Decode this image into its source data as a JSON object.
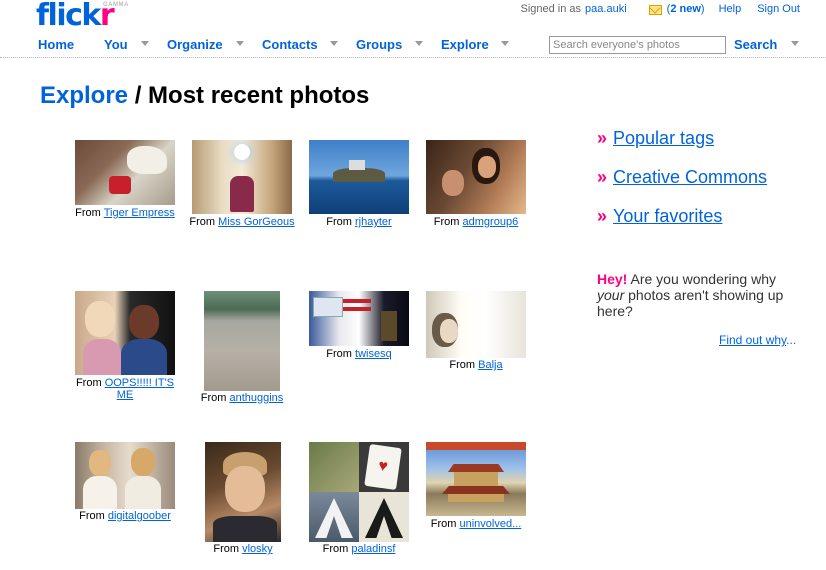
{
  "logo": {
    "part1": "flick",
    "part2": "r",
    "badge": "GAMMA"
  },
  "top": {
    "signed_in_as": "Signed in as",
    "username": "paa.auki",
    "mail_count": "2 new",
    "help": "Help",
    "sign_out": "Sign Out"
  },
  "nav": {
    "home": "Home",
    "you": "You",
    "organize": "Organize",
    "contacts": "Contacts",
    "groups": "Groups",
    "explore": "Explore",
    "search_placeholder": "Search everyone's photos",
    "search_button": "Search"
  },
  "heading": {
    "explore": "Explore",
    "sep": " / ",
    "title": "Most recent photos"
  },
  "from_label": "From",
  "photos": [
    {
      "user": "Tiger Empress",
      "icon": "polar-bear-photo"
    },
    {
      "user": "Miss GorGeous",
      "icon": "mirror-selfie-photo"
    },
    {
      "user": "rjhayter",
      "icon": "island-sea-photo"
    },
    {
      "user": "admgroup6",
      "icon": "portrait-photo"
    },
    {
      "user": "OOPS!!!!! IT'S ME",
      "icon": "women-photo"
    },
    {
      "user": "anthuggins",
      "icon": "beach-photo"
    },
    {
      "user": "twisesq",
      "icon": "podium-photo"
    },
    {
      "user": "Balja",
      "icon": "bright-portrait-photo"
    },
    {
      "user": "digitalgoober",
      "icon": "bride-photo"
    },
    {
      "user": "vlosky",
      "icon": "young-man-photo"
    },
    {
      "user": "paladinsf",
      "icon": "letters-photo"
    },
    {
      "user": "uninvolved...",
      "icon": "pagoda-photo"
    }
  ],
  "side": {
    "raquo": "»",
    "popular_tags": "Popular tags",
    "creative_commons": "Creative Commons",
    "your_favorites": "Your favorites",
    "hey": "Hey!",
    "q1": " Are you wondering why ",
    "your": "your",
    "q2": " photos aren't showing up here?",
    "find_out": "Find out why",
    "ellipsis": "..."
  },
  "colors": {
    "brand_blue": "#0063dc",
    "brand_pink": "#ff0084"
  }
}
